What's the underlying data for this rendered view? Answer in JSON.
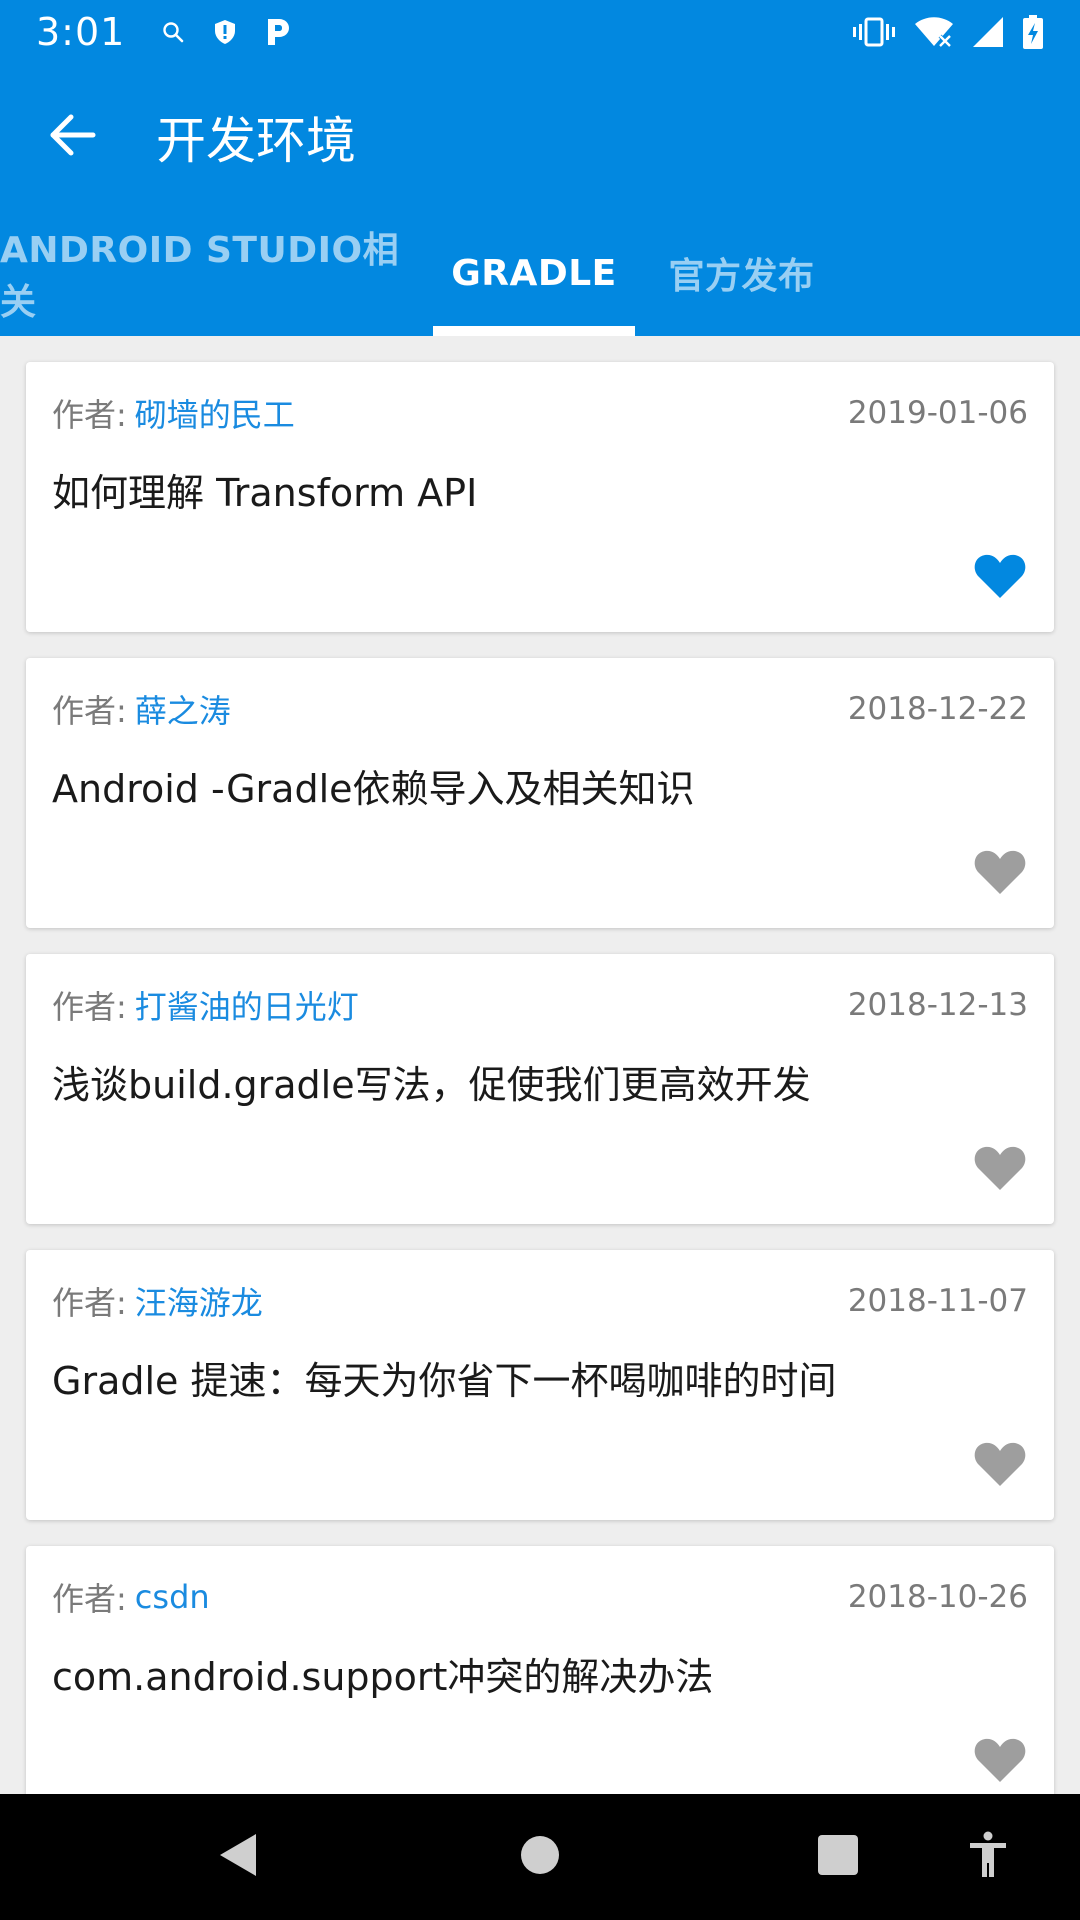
{
  "status_bar": {
    "time": "3:01",
    "left_icons": [
      "search-icon",
      "shield-icon",
      "p-app-icon"
    ],
    "right_icons": [
      "vibrate-icon",
      "wifi-off-icon",
      "signal-icon",
      "battery-charging-icon"
    ]
  },
  "app_bar": {
    "title": "开发环境",
    "back_icon": "arrow-back-icon"
  },
  "tabs": [
    {
      "label": "ANDROID STUDIO相关",
      "active": false
    },
    {
      "label": "GRADLE",
      "active": true
    },
    {
      "label": "官方发布",
      "active": false
    }
  ],
  "articles": [
    {
      "author_label": "作者:",
      "author": "砌墙的民工",
      "date": "2019-01-06",
      "title": "如何理解 Transform API",
      "favorited": true
    },
    {
      "author_label": "作者:",
      "author": "薛之涛",
      "date": "2018-12-22",
      "title": "Android -Gradle依赖导入及相关知识",
      "favorited": false
    },
    {
      "author_label": "作者:",
      "author": "打酱油的日光灯",
      "date": "2018-12-13",
      "title": "浅谈build.gradle写法，促使我们更高效开发",
      "favorited": false
    },
    {
      "author_label": "作者:",
      "author": "汪海游龙",
      "date": "2018-11-07",
      "title": "Gradle 提速：每天为你省下一杯喝咖啡的时间",
      "favorited": false
    },
    {
      "author_label": "作者:",
      "author": "csdn",
      "date": "2018-10-26",
      "title": "com.android.support冲突的解决办法",
      "favorited": false
    }
  ],
  "colors": {
    "primary": "#0288e0",
    "author": "#1a8be0",
    "favorite_active": "#0288e0",
    "favorite_inactive": "#9e9e9e"
  },
  "nav_bar": {
    "icons": [
      "back-triangle-icon",
      "home-circle-icon",
      "recents-square-icon",
      "accessibility-icon"
    ]
  }
}
